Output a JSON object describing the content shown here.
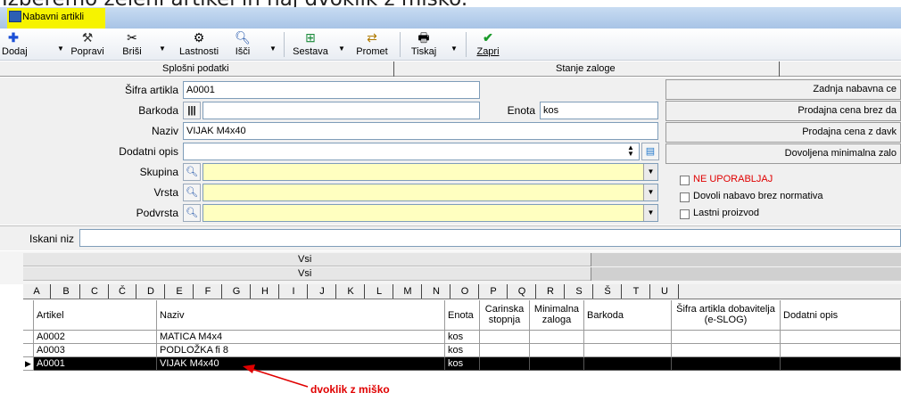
{
  "caption": "Izberemo želeni artikel in naj dvoklik z miško.",
  "window": {
    "title": "Nabavni artikli"
  },
  "toolbar": {
    "items": [
      {
        "label": "Dodaj",
        "icon": "plus-icon"
      },
      {
        "label": "Popravi",
        "icon": "hammer-icon"
      },
      {
        "label": "Briši",
        "icon": "scissors-icon"
      },
      {
        "label": "Lastnosti",
        "icon": "properties-icon"
      },
      {
        "label": "Išči",
        "icon": "search-icon"
      },
      {
        "label": "Sestava",
        "icon": "assembly-icon"
      },
      {
        "label": "Promet",
        "icon": "traffic-icon"
      },
      {
        "label": "Tiskaj",
        "icon": "printer-icon"
      },
      {
        "label": "Zapri",
        "icon": "checkmark-icon"
      }
    ]
  },
  "tabs": [
    "Splošni podatki",
    "Stanje zaloge"
  ],
  "form": {
    "sifra_label": "Šifra artikla",
    "sifra": "A0001",
    "barkoda_label": "Barkoda",
    "barkoda": "",
    "enota_label": "Enota",
    "enota": "kos",
    "naziv_label": "Naziv",
    "naziv": "VIJAK M4x40",
    "dodatni_label": "Dodatni opis",
    "dodatni": "",
    "skupina_label": "Skupina",
    "skupina": "",
    "vrsta_label": "Vrsta",
    "vrsta": "",
    "podvrsta_label": "Podvrsta",
    "podvrsta": ""
  },
  "right": {
    "zadnja": "Zadnja nabavna ce",
    "prodajna_brez": "Prodajna cena brez da",
    "prodajna_z": "Prodajna cena z davk",
    "dovoljena": "Dovoljena minimalna zalo",
    "chk_neuporabljaj": "NE UPORABLJAJ",
    "chk_dovoli": "Dovoli nabavo brez normativa",
    "chk_lastni": "Lastni proizvod",
    "red": "#e00000"
  },
  "search": {
    "label": "Iskani niz",
    "value": ""
  },
  "grid": {
    "band1": "Vsi",
    "band2": "Vsi",
    "letters": [
      "A",
      "B",
      "C",
      "Č",
      "D",
      "E",
      "F",
      "G",
      "H",
      "I",
      "J",
      "K",
      "L",
      "M",
      "N",
      "O",
      "P",
      "Q",
      "R",
      "S",
      "Š",
      "T",
      "U"
    ],
    "headers": [
      "Artikel",
      "Naziv",
      "Enota",
      "Carinska stopnja",
      "Minimalna zaloga",
      "Barkoda",
      "Šifra artikla dobavitelja (e-SLOG)",
      "Dodatni opis"
    ],
    "rows": [
      [
        "A0002",
        "MATICA M4x4",
        "kos",
        "",
        "",
        "",
        "",
        ""
      ],
      [
        "A0003",
        "PODLOŽKA fi 8",
        "kos",
        "",
        "",
        "",
        "",
        ""
      ],
      [
        "A0001",
        "VIJAK M4x40",
        "kos",
        "",
        "",
        "",
        "",
        ""
      ]
    ],
    "selected_row": 2
  },
  "annotation": "dvoklik z miško"
}
